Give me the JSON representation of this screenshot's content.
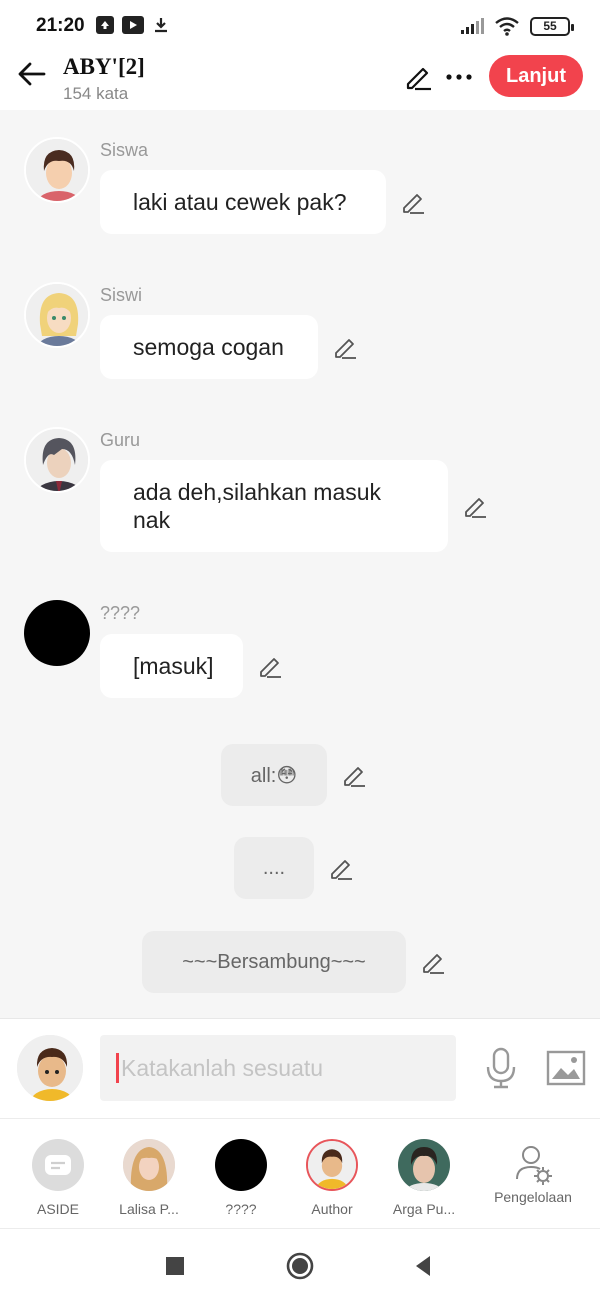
{
  "status_bar": {
    "time": "21:20",
    "battery": "55"
  },
  "header": {
    "title": "ABY'[2]",
    "subtitle": "154 kata",
    "next_label": "Lanjut"
  },
  "messages": [
    {
      "speaker": "Siswa",
      "text": "laki atau cewek pak?"
    },
    {
      "speaker": "Siswi",
      "text": "semoga cogan"
    },
    {
      "speaker": "Guru",
      "text": "ada deh,silahkan masuk nak"
    },
    {
      "speaker": "????",
      "text": "[masuk]"
    }
  ],
  "narrations": [
    "all:😳",
    "....",
    "~~~Bersambung~~~"
  ],
  "composer": {
    "placeholder": "Katakanlah sesuatu"
  },
  "characters": [
    {
      "label": "ASIDE"
    },
    {
      "label": "Lalisa P..."
    },
    {
      "label": "????"
    },
    {
      "label": "Author"
    },
    {
      "label": "Arga Pu..."
    },
    {
      "label": "Pengelolaan"
    }
  ],
  "colors": {
    "accent": "#f2434d",
    "background": "#f6f6f6",
    "bubble": "#ffffff",
    "narration": "#ececec"
  }
}
